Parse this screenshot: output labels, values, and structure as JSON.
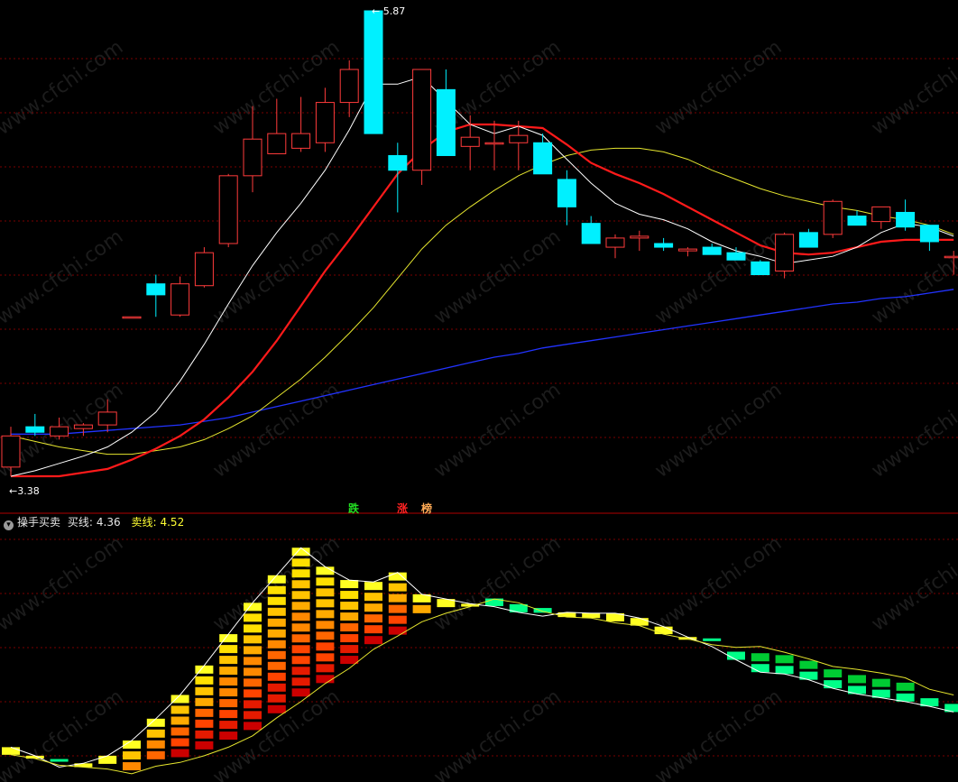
{
  "watermark": "www.cfchi.com",
  "main_chart": {
    "high_marker": "5.87",
    "low_marker": "3.38",
    "signals": {
      "fall": "跌",
      "rise": "涨",
      "third": "榜"
    }
  },
  "indicator": {
    "name": "操手买卖",
    "buy_label": "买线:",
    "buy_value": "4.36",
    "sell_label": "卖线:",
    "sell_value": "4.52"
  },
  "colors": {
    "up_candle": "#ff3b3b",
    "down_candle": "#00f0ff",
    "ma_fast": "#ffffff",
    "ma_mid": "#ff1a1a",
    "ma_slow": "#e6e62e",
    "ma_long": "#2233ff",
    "grid": "#7a0000",
    "separator": "#b00000"
  },
  "chart_data": [
    {
      "type": "candlestick",
      "ylim": [
        3.3,
        5.9
      ],
      "candles": [
        {
          "o": 3.38,
          "h": 3.6,
          "l": 3.33,
          "c": 3.55
        },
        {
          "o": 3.6,
          "h": 3.67,
          "l": 3.55,
          "c": 3.57
        },
        {
          "o": 3.55,
          "h": 3.65,
          "l": 3.53,
          "c": 3.6
        },
        {
          "o": 3.59,
          "h": 3.62,
          "l": 3.55,
          "c": 3.61
        },
        {
          "o": 3.61,
          "h": 3.75,
          "l": 3.57,
          "c": 3.68
        },
        {
          "o": 4.2,
          "h": 4.2,
          "l": 4.2,
          "c": 4.2
        },
        {
          "o": 4.38,
          "h": 4.43,
          "l": 4.2,
          "c": 4.32
        },
        {
          "o": 4.21,
          "h": 4.42,
          "l": 4.2,
          "c": 4.38
        },
        {
          "o": 4.37,
          "h": 4.58,
          "l": 4.36,
          "c": 4.55
        },
        {
          "o": 4.6,
          "h": 4.98,
          "l": 4.58,
          "c": 4.97
        },
        {
          "o": 4.97,
          "h": 5.35,
          "l": 4.88,
          "c": 5.17
        },
        {
          "o": 5.09,
          "h": 5.39,
          "l": 5.09,
          "c": 5.2
        },
        {
          "o": 5.12,
          "h": 5.4,
          "l": 5.1,
          "c": 5.2
        },
        {
          "o": 5.15,
          "h": 5.45,
          "l": 5.1,
          "c": 5.37
        },
        {
          "o": 5.37,
          "h": 5.6,
          "l": 5.29,
          "c": 5.55
        },
        {
          "o": 5.87,
          "h": 5.87,
          "l": 5.2,
          "c": 5.2
        },
        {
          "o": 5.08,
          "h": 5.15,
          "l": 4.77,
          "c": 5.0
        },
        {
          "o": 5.0,
          "h": 5.55,
          "l": 4.92,
          "c": 5.55
        },
        {
          "o": 5.44,
          "h": 5.55,
          "l": 5.08,
          "c": 5.08
        },
        {
          "o": 5.13,
          "h": 5.3,
          "l": 5.0,
          "c": 5.18
        },
        {
          "o": 5.15,
          "h": 5.27,
          "l": 5.0,
          "c": 5.15
        },
        {
          "o": 5.15,
          "h": 5.27,
          "l": 5.0,
          "c": 5.19
        },
        {
          "o": 5.15,
          "h": 5.2,
          "l": 4.98,
          "c": 4.98
        },
        {
          "o": 4.95,
          "h": 5.0,
          "l": 4.7,
          "c": 4.8
        },
        {
          "o": 4.71,
          "h": 4.75,
          "l": 4.6,
          "c": 4.6
        },
        {
          "o": 4.58,
          "h": 4.65,
          "l": 4.52,
          "c": 4.63
        },
        {
          "o": 4.63,
          "h": 4.67,
          "l": 4.56,
          "c": 4.64
        },
        {
          "o": 4.6,
          "h": 4.63,
          "l": 4.56,
          "c": 4.58
        },
        {
          "o": 4.56,
          "h": 4.58,
          "l": 4.53,
          "c": 4.57
        },
        {
          "o": 4.58,
          "h": 4.6,
          "l": 4.54,
          "c": 4.54
        },
        {
          "o": 4.55,
          "h": 4.58,
          "l": 4.51,
          "c": 4.51
        },
        {
          "o": 4.5,
          "h": 4.51,
          "l": 4.43,
          "c": 4.43
        },
        {
          "o": 4.45,
          "h": 4.66,
          "l": 4.41,
          "c": 4.65
        },
        {
          "o": 4.66,
          "h": 4.68,
          "l": 4.58,
          "c": 4.58
        },
        {
          "o": 4.65,
          "h": 4.84,
          "l": 4.63,
          "c": 4.83
        },
        {
          "o": 4.75,
          "h": 4.78,
          "l": 4.7,
          "c": 4.7
        },
        {
          "o": 4.72,
          "h": 4.8,
          "l": 4.68,
          "c": 4.8
        },
        {
          "o": 4.77,
          "h": 4.84,
          "l": 4.67,
          "c": 4.69
        },
        {
          "o": 4.7,
          "h": 4.68,
          "l": 4.56,
          "c": 4.61
        },
        {
          "o": 4.53,
          "h": 4.56,
          "l": 4.43,
          "c": 4.53
        }
      ],
      "ma_fast": [
        3.33,
        3.36,
        3.4,
        3.44,
        3.49,
        3.57,
        3.68,
        3.85,
        4.05,
        4.27,
        4.48,
        4.66,
        4.82,
        5.0,
        5.22,
        5.47,
        5.47,
        5.51,
        5.38,
        5.25,
        5.2,
        5.24,
        5.19,
        5.06,
        4.93,
        4.82,
        4.76,
        4.73,
        4.68,
        4.61,
        4.56,
        4.53,
        4.49,
        4.51,
        4.53,
        4.58,
        4.66,
        4.71,
        4.69,
        4.64
      ],
      "ma_mid": [
        3.33,
        3.33,
        3.33,
        3.35,
        3.37,
        3.42,
        3.48,
        3.55,
        3.64,
        3.76,
        3.9,
        4.07,
        4.26,
        4.45,
        4.62,
        4.8,
        4.98,
        5.11,
        5.21,
        5.25,
        5.25,
        5.24,
        5.23,
        5.14,
        5.04,
        4.98,
        4.93,
        4.87,
        4.8,
        4.73,
        4.66,
        4.59,
        4.55,
        4.54,
        4.55,
        4.58,
        4.61,
        4.62,
        4.62,
        4.62
      ],
      "ma_slow": [
        3.55,
        3.52,
        3.49,
        3.47,
        3.45,
        3.45,
        3.47,
        3.49,
        3.53,
        3.59,
        3.66,
        3.76,
        3.86,
        3.98,
        4.11,
        4.25,
        4.41,
        4.57,
        4.7,
        4.8,
        4.89,
        4.97,
        5.03,
        5.08,
        5.11,
        5.12,
        5.12,
        5.1,
        5.06,
        5.0,
        4.95,
        4.9,
        4.86,
        4.83,
        4.8,
        4.78,
        4.75,
        4.73,
        4.7,
        4.65
      ],
      "ma_long": [
        3.56,
        3.56,
        3.56,
        3.57,
        3.58,
        3.59,
        3.6,
        3.61,
        3.63,
        3.65,
        3.68,
        3.71,
        3.74,
        3.77,
        3.8,
        3.83,
        3.86,
        3.89,
        3.92,
        3.95,
        3.98,
        4.0,
        4.03,
        4.05,
        4.07,
        4.09,
        4.11,
        4.13,
        4.15,
        4.17,
        4.19,
        4.21,
        4.23,
        4.25,
        4.27,
        4.28,
        4.3,
        4.31,
        4.33,
        4.35
      ]
    },
    {
      "type": "heatmap",
      "name": "操手买卖",
      "ylim": [
        3.2,
        5.8
      ],
      "buy_line": [
        3.55,
        3.46,
        3.34,
        3.38,
        3.46,
        3.62,
        3.85,
        4.1,
        4.41,
        4.74,
        5.07,
        5.36,
        5.65,
        5.45,
        5.31,
        5.29,
        5.39,
        5.16,
        5.11,
        5.06,
        5.03,
        4.97,
        4.93,
        4.97,
        4.96,
        4.96,
        4.91,
        4.82,
        4.71,
        4.61,
        4.47,
        4.34,
        4.32,
        4.26,
        4.17,
        4.11,
        4.07,
        4.03,
        3.98,
        3.92
      ],
      "sell_line": [
        3.47,
        3.43,
        3.36,
        3.34,
        3.32,
        3.27,
        3.35,
        3.39,
        3.46,
        3.55,
        3.67,
        3.86,
        4.03,
        4.22,
        4.38,
        4.58,
        4.72,
        4.87,
        4.96,
        5.03,
        5.11,
        5.07,
        4.98,
        4.92,
        4.91,
        4.86,
        4.83,
        4.74,
        4.69,
        4.63,
        4.6,
        4.61,
        4.55,
        4.48,
        4.4,
        4.37,
        4.33,
        4.28,
        4.16,
        4.1
      ]
    }
  ]
}
